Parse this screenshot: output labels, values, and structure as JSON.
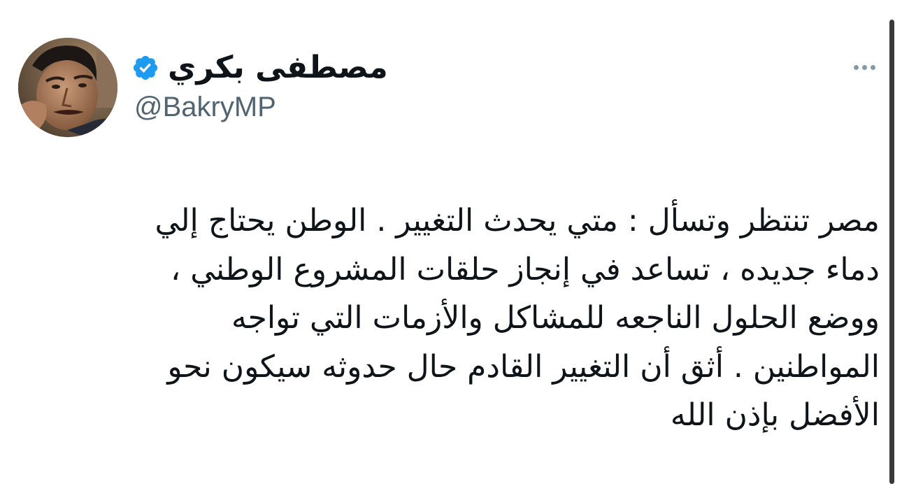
{
  "author": {
    "display_name": "مصطفى بكري",
    "handle": "@BakryMP",
    "verified": true,
    "verified_color": "#1d9bf0"
  },
  "icons": {
    "verified": "verified-badge-icon",
    "more": "more-horizontal-icon"
  },
  "tweet": {
    "lines": [
      "مصر تنتظر وتسأل : متي يحدث التغيير . الوطن يحتاج إلي",
      "دماء جديده ، تساعد في إنجاز حلقات المشروع الوطني ،",
      "ووضع الحلول الناجعه للمشاكل والأزمات التي تواجه",
      "المواطنين . أثق أن التغيير القادم حال حدوثه سيكون نحو",
      "الأفضل بإذن الله"
    ]
  },
  "colors": {
    "text": "#0f1419",
    "secondary_text": "#536471",
    "background": "#ffffff"
  }
}
